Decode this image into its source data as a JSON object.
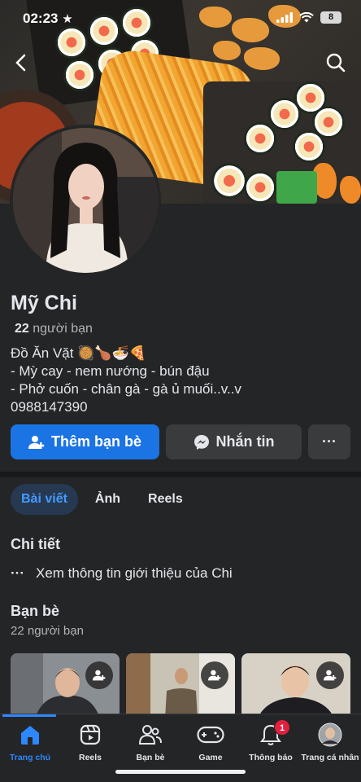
{
  "status_bar": {
    "time": "02:23",
    "battery": "8"
  },
  "profile": {
    "name": "Mỹ Chi",
    "friend_count_number": "22",
    "friend_count_label": "người bạn",
    "bio_lines": [
      "Đồ Ăn Vặt 🥘🍗🍜🍕",
      "- Mỳ cay - nem nướng - bún đậu",
      "- Phở cuốn - chân gà - gà ủ muối..v..v",
      "0988147390"
    ]
  },
  "actions": {
    "add_friend": "Thêm bạn bè",
    "message": "Nhắn tin",
    "more": "···"
  },
  "tabs": [
    {
      "label": "Bài viết",
      "active": true
    },
    {
      "label": "Ảnh",
      "active": false
    },
    {
      "label": "Reels",
      "active": false
    }
  ],
  "details": {
    "heading": "Chi tiết",
    "intro_icon": "···",
    "intro_text": "Xem thông tin giới thiệu của Chi"
  },
  "friends": {
    "heading": "Bạn bè",
    "count": "22 người bạn"
  },
  "nav": {
    "items": [
      {
        "label": "Trang chủ",
        "icon": "home-icon",
        "active": true
      },
      {
        "label": "Reels",
        "icon": "reels-icon",
        "active": false
      },
      {
        "label": "Bạn bè",
        "icon": "friends-icon",
        "active": false
      },
      {
        "label": "Game",
        "icon": "gamepad-icon",
        "active": false
      },
      {
        "label": "Thông báo",
        "icon": "bell-icon",
        "active": false,
        "badge": "1"
      },
      {
        "label": "Trang cá nhân",
        "icon": "profile-avatar",
        "active": false
      }
    ]
  },
  "colors": {
    "accent": "#1b74e4",
    "background": "#242526",
    "badge": "#e41e3f"
  }
}
